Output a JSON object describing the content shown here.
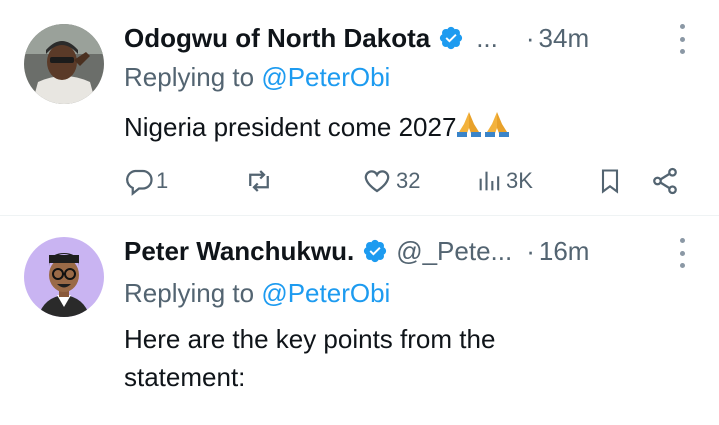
{
  "tweets": [
    {
      "author": "Odogwu of North Dakota",
      "ellipsis": "...",
      "dot": "·",
      "time": "34m",
      "replying_prefix": "Replying to ",
      "replying_to": "@PeterObi",
      "text": "Nigeria president come 2027",
      "emoji": "🙏🙏",
      "stats": {
        "replies": "1",
        "reposts": "",
        "likes": "32",
        "views": "3K"
      }
    },
    {
      "author": "Peter Wanchukwu.",
      "handle": "@_Pete...",
      "dot": "·",
      "time": "16m",
      "replying_prefix": "Replying to ",
      "replying_to": "@PeterObi",
      "text": "Here are the key points from the statement:"
    }
  ],
  "colors": {
    "accent": "#1d9bf0",
    "muted": "#536471",
    "text": "#0f1419",
    "verified": "#1d9bf0"
  }
}
